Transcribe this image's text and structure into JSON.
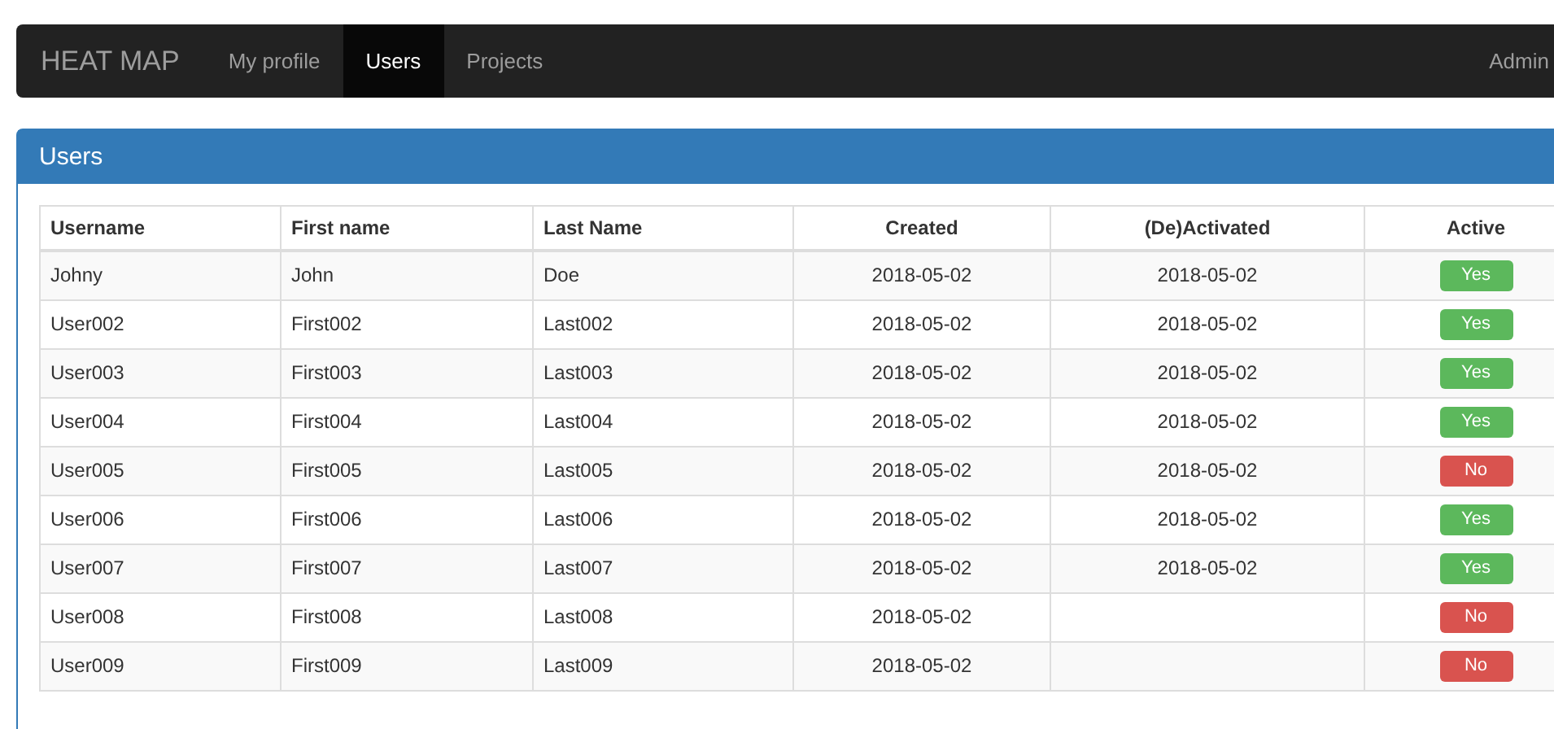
{
  "navbar": {
    "brand": "HEAT MAP",
    "items": [
      {
        "label": "My profile",
        "selected": false
      },
      {
        "label": "Users",
        "selected": true
      },
      {
        "label": "Projects",
        "selected": false
      }
    ],
    "user_menu": "Admin"
  },
  "panel": {
    "title": "Users"
  },
  "table": {
    "columns": [
      "Username",
      "First name",
      "Last Name",
      "Created",
      "(De)Activated",
      "Active"
    ],
    "rows": [
      {
        "username": "Johny",
        "first": "John",
        "last": "Doe",
        "created": "2018-05-02",
        "deactivated": "2018-05-02",
        "active": true,
        "badge": "Yes"
      },
      {
        "username": "User002",
        "first": "First002",
        "last": "Last002",
        "created": "2018-05-02",
        "deactivated": "2018-05-02",
        "active": true,
        "badge": "Yes"
      },
      {
        "username": "User003",
        "first": "First003",
        "last": "Last003",
        "created": "2018-05-02",
        "deactivated": "2018-05-02",
        "active": true,
        "badge": "Yes"
      },
      {
        "username": "User004",
        "first": "First004",
        "last": "Last004",
        "created": "2018-05-02",
        "deactivated": "2018-05-02",
        "active": true,
        "badge": "Yes"
      },
      {
        "username": "User005",
        "first": "First005",
        "last": "Last005",
        "created": "2018-05-02",
        "deactivated": "2018-05-02",
        "active": false,
        "badge": "No"
      },
      {
        "username": "User006",
        "first": "First006",
        "last": "Last006",
        "created": "2018-05-02",
        "deactivated": "2018-05-02",
        "active": true,
        "badge": "Yes"
      },
      {
        "username": "User007",
        "first": "First007",
        "last": "Last007",
        "created": "2018-05-02",
        "deactivated": "2018-05-02",
        "active": true,
        "badge": "Yes"
      },
      {
        "username": "User008",
        "first": "First008",
        "last": "Last008",
        "created": "2018-05-02",
        "active": false,
        "badge": "No"
      },
      {
        "username": "User009",
        "first": "First009",
        "last": "Last009",
        "created": "2018-05-02",
        "active": false,
        "badge": "No"
      }
    ]
  }
}
